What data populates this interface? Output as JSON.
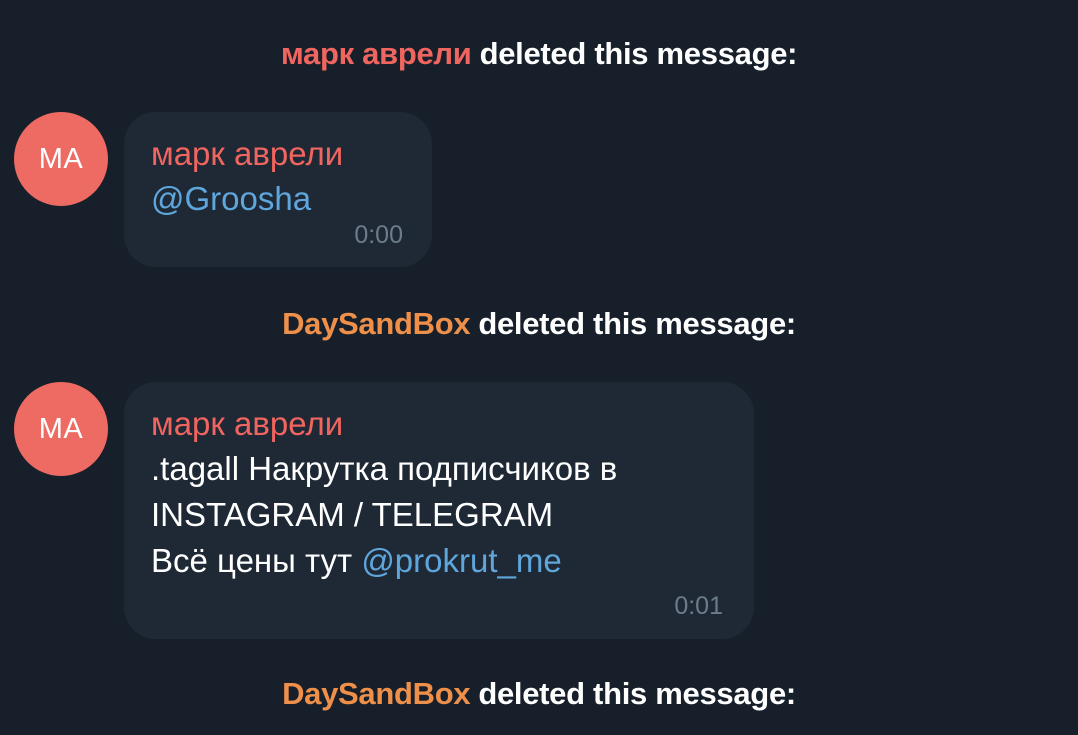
{
  "colors": {
    "background": "#17202a",
    "bubble": "#1e2935",
    "user_mark": "#f0655f",
    "user_daysandbox": "#ee8f4a",
    "avatar_bg": "#ee6b64",
    "mention": "#5ea6dc",
    "time": "#6d7c8b"
  },
  "events": [
    {
      "actor": "марк аврели",
      "text": "deleted this message:",
      "message": {
        "avatar_initials": "MA",
        "sender": "марк аврели",
        "mention": "@Groosha",
        "time": "0:00"
      }
    },
    {
      "actor": "DaySandBox",
      "text": "deleted this message:",
      "message": {
        "avatar_initials": "MA",
        "sender": "марк аврели",
        "line1": ".tagall Накрутка подписчиков в",
        "line2": "INSTAGRAM / TELEGRAM",
        "line3_prefix": "Всё цены тут",
        "line3_mention": "@prokrut_me",
        "time": "0:01"
      }
    },
    {
      "actor": "DaySandBox",
      "text": "deleted this message:"
    }
  ]
}
